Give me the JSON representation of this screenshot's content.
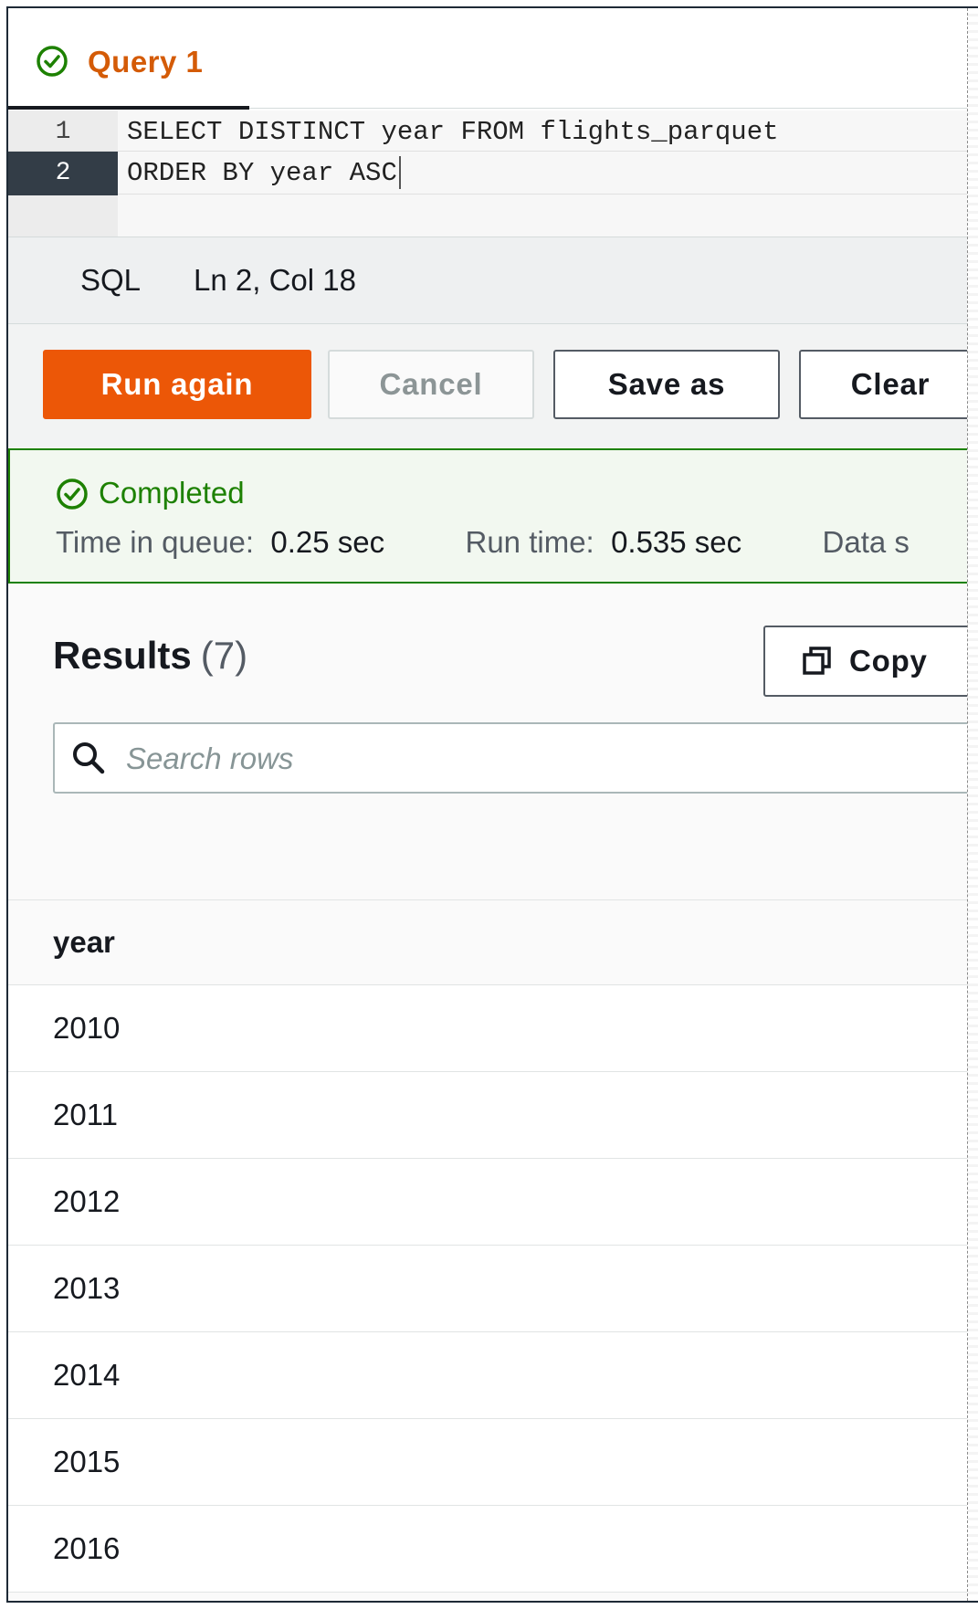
{
  "tab": {
    "label": "Query 1",
    "status_icon": "check-circle-icon"
  },
  "editor": {
    "lines": [
      {
        "number": "1",
        "code": "SELECT DISTINCT year FROM flights_parquet"
      },
      {
        "number": "2",
        "code": "ORDER BY year ASC"
      }
    ]
  },
  "statusbar": {
    "language": "SQL",
    "position": "Ln 2, Col 18"
  },
  "toolbar": {
    "run_again": "Run again",
    "cancel": "Cancel",
    "save_as": "Save as",
    "clear": "Clear"
  },
  "alert": {
    "title": "Completed",
    "queue_label": "Time in queue:",
    "queue_value": "0.25 sec",
    "run_label": "Run time:",
    "run_value": "0.535 sec",
    "data_label": "Data s"
  },
  "results": {
    "title": "Results",
    "count": "(7)",
    "copy_label": "Copy",
    "search_placeholder": "Search rows",
    "column": "year",
    "rows": [
      "2010",
      "2011",
      "2012",
      "2013",
      "2014",
      "2015",
      "2016"
    ]
  },
  "colors": {
    "accent": "#ec5707",
    "tab_label": "#d45b07",
    "success": "#1d8102"
  }
}
